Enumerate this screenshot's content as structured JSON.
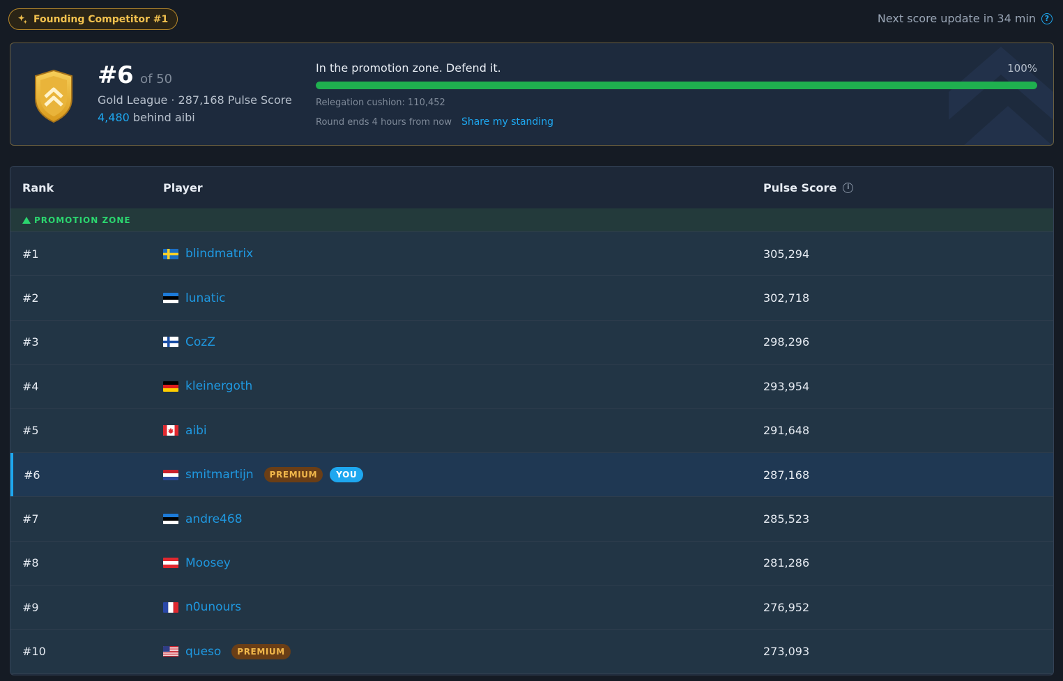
{
  "top": {
    "founder_badge": "Founding Competitor #1",
    "next_update": "Next score update in 34 min"
  },
  "standing": {
    "rank": "#6",
    "of_total": "of 50",
    "league_line": "Gold League · 287,168 Pulse Score",
    "behind_amount": "4,480",
    "behind_text": "behind aibi",
    "zone_message": "In the promotion zone. Defend it.",
    "progress_label": "100%",
    "progress_fraction": 1.0,
    "cushion": "Relegation cushion: 110,452",
    "round_ends": "Round ends 4 hours from now",
    "share_label": "Share my standing"
  },
  "leaderboard": {
    "headers": {
      "rank": "Rank",
      "player": "Player",
      "score": "Pulse Score"
    },
    "zone_label": "PROMOTION ZONE",
    "badges": {
      "premium": "PREMIUM",
      "you": "YOU"
    },
    "rows": [
      {
        "rank": "#1",
        "name": "blindmatrix",
        "flag": "se",
        "score": "305,294"
      },
      {
        "rank": "#2",
        "name": "lunatic",
        "flag": "ee",
        "score": "302,718"
      },
      {
        "rank": "#3",
        "name": "CozZ",
        "flag": "fi",
        "score": "298,296"
      },
      {
        "rank": "#4",
        "name": "kleinergoth",
        "flag": "de",
        "score": "293,954"
      },
      {
        "rank": "#5",
        "name": "aibi",
        "flag": "ca",
        "score": "291,648"
      },
      {
        "rank": "#6",
        "name": "smitmartijn",
        "flag": "nl",
        "score": "287,168"
      },
      {
        "rank": "#7",
        "name": "andre468",
        "flag": "ee",
        "score": "285,523"
      },
      {
        "rank": "#8",
        "name": "Moosey",
        "flag": "at",
        "score": "281,286"
      },
      {
        "rank": "#9",
        "name": "n0unours",
        "flag": "fr",
        "score": "276,952"
      },
      {
        "rank": "#10",
        "name": "queso",
        "flag": "us",
        "score": "273,093"
      }
    ]
  },
  "colors": {
    "accent": "#1ea7ef",
    "gold": "#f2c14e",
    "success": "#1fb04f",
    "premium_bg": "#6a3e16"
  }
}
